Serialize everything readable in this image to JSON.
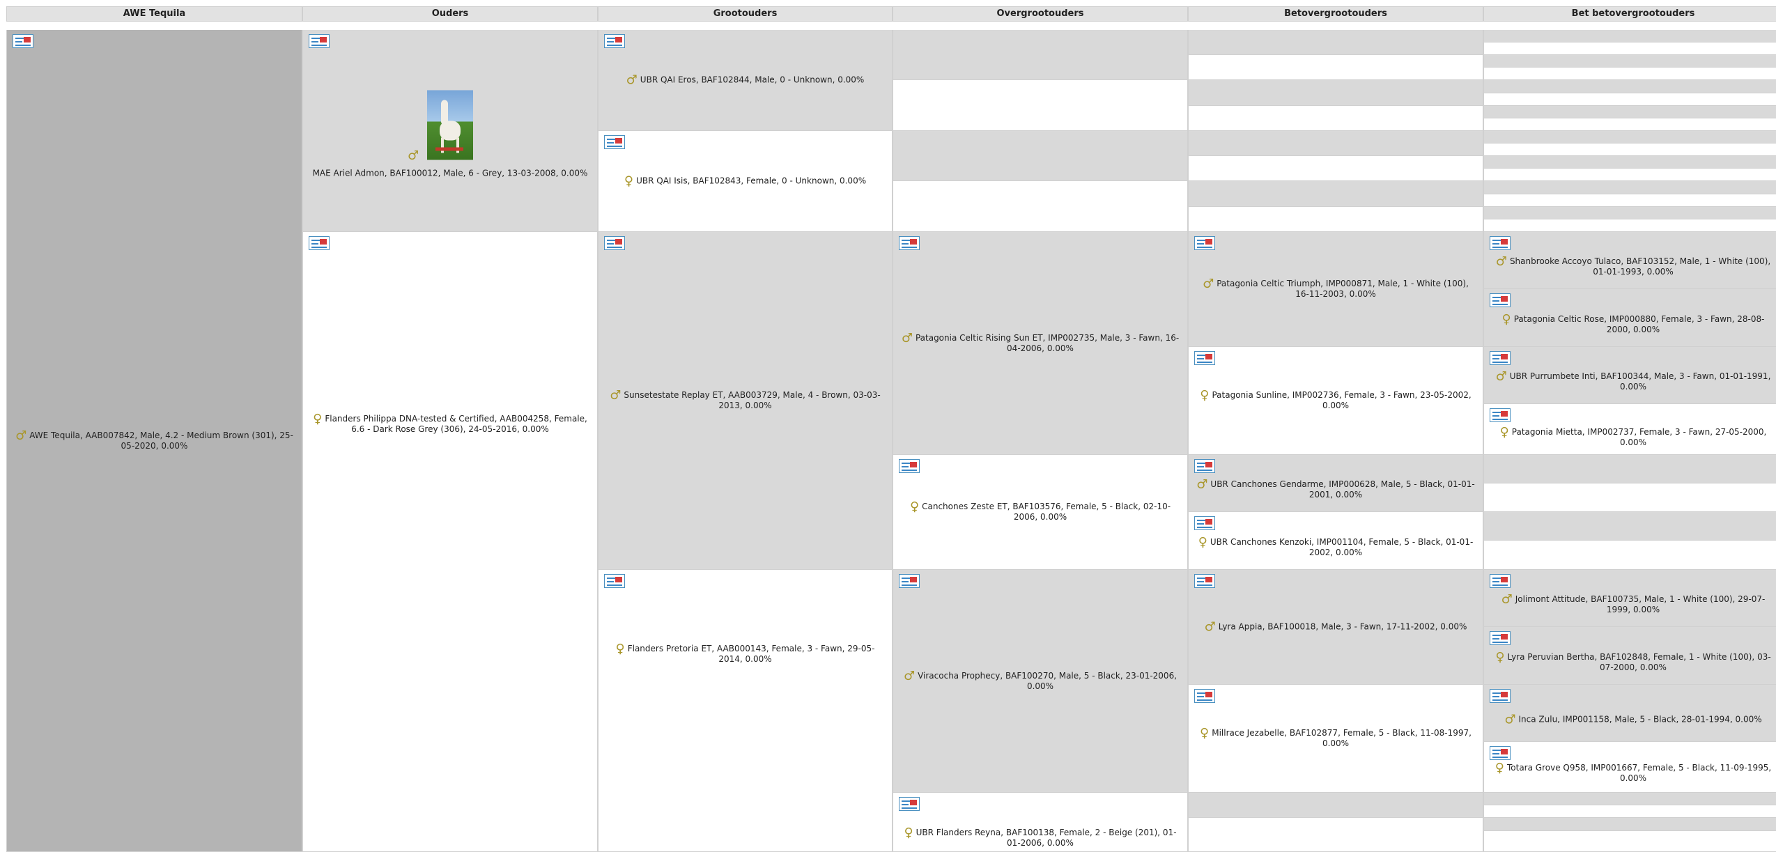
{
  "headers": {
    "h0": "AWE Tequila",
    "h1": "Ouders",
    "h2": "Grootouders",
    "h3": "Overgrootouders",
    "h4": "Betovergrootouders",
    "h5": "Bet betovergrootouders"
  },
  "icons": {
    "male": "♂",
    "female": "♀",
    "card": "profile-card-icon"
  },
  "colors": {
    "gender_symbol": "#a9962a",
    "grey_cell": "#d9d9d9",
    "self_cell": "#b4b4b4"
  },
  "animals": {
    "self": {
      "label": "AWE Tequila, AAB007842, Male, 4.2 - Medium Brown (301), 25-05-2020, 0.00%"
    },
    "sire": {
      "label": "MAE Ariel Admon, BAF100012, Male, 6 - Grey, 13-03-2008, 0.00%"
    },
    "dam": {
      "label": "Flanders Philippa DNA-tested & Certified, AAB004258, Female, 6.6 - Dark Rose Grey (306), 24-05-2016, 0.00%"
    },
    "gp1": {
      "label": "UBR QAI Eros, BAF102844, Male, 0 - Unknown, 0.00%"
    },
    "gp2": {
      "label": "UBR QAI Isis, BAF102843, Female, 0 - Unknown, 0.00%"
    },
    "gp3": {
      "label": "Sunsetestate Replay ET, AAB003729, Male, 4 - Brown, 03-03-2013, 0.00%"
    },
    "gp4": {
      "label": "Flanders Pretoria ET, AAB000143, Female, 3 - Fawn, 29-05-2014, 0.00%"
    },
    "ggp5": {
      "label": "Patagonia Celtic Rising Sun ET, IMP002735, Male, 3 - Fawn, 16-04-2006, 0.00%"
    },
    "ggp6": {
      "label": "Canchones Zeste ET, BAF103576, Female, 5 - Black, 02-10-2006, 0.00%"
    },
    "ggp7": {
      "label": "Viracocha Prophecy, BAF100270, Male, 5 - Black, 23-01-2006, 0.00%"
    },
    "ggp8": {
      "label": "UBR Flanders Reyna, BAF100138, Female, 2 - Beige (201), 01-01-2006, 0.00%"
    },
    "gggp9": {
      "label": "Patagonia Celtic Triumph, IMP000871, Male, 1 - White (100), 16-11-2003, 0.00%"
    },
    "gggp10": {
      "label": "Patagonia Sunline, IMP002736, Female, 3 - Fawn, 23-05-2002, 0.00%"
    },
    "gggp11": {
      "label": "UBR Canchones Gendarme, IMP000628, Male, 5 - Black, 01-01-2001, 0.00%"
    },
    "gggp12": {
      "label": "UBR Canchones Kenzoki, IMP001104, Female, 5 - Black, 01-01-2002, 0.00%"
    },
    "gggp13": {
      "label": "Lyra Appia, BAF100018, Male, 3 - Fawn, 17-11-2002, 0.00%"
    },
    "gggp14": {
      "label": "Millrace Jezabelle, BAF102877, Female, 5 - Black, 11-08-1997, 0.00%"
    },
    "g5_1": {
      "label": "Shanbrooke Accoyo Tulaco, BAF103152, Male, 1 - White (100), 01-01-1993, 0.00%"
    },
    "g5_2": {
      "label": "Patagonia Celtic Rose, IMP000880, Female, 3 - Fawn, 28-08-2000, 0.00%"
    },
    "g5_3": {
      "label": "UBR Purrumbete Inti, BAF100344, Male, 3 - Fawn, 01-01-1991, 0.00%"
    },
    "g5_4": {
      "label": "Patagonia Mietta, IMP002737, Female, 3 - Fawn, 27-05-2000, 0.00%"
    },
    "g5_5": {
      "label": "Jolimont Attitude, BAF100735, Male, 1 - White (100), 29-07-1999, 0.00%"
    },
    "g5_6": {
      "label": "Lyra Peruvian Bertha, BAF102848, Female, 1 - White (100), 03-07-2000, 0.00%"
    },
    "g5_7": {
      "label": "Inca Zulu, IMP001158, Male, 5 - Black, 28-01-1994, 0.00%"
    },
    "g5_8": {
      "label": "Totara Grove Q958, IMP001667, Female, 5 - Black, 11-09-1995, 0.00%"
    }
  }
}
